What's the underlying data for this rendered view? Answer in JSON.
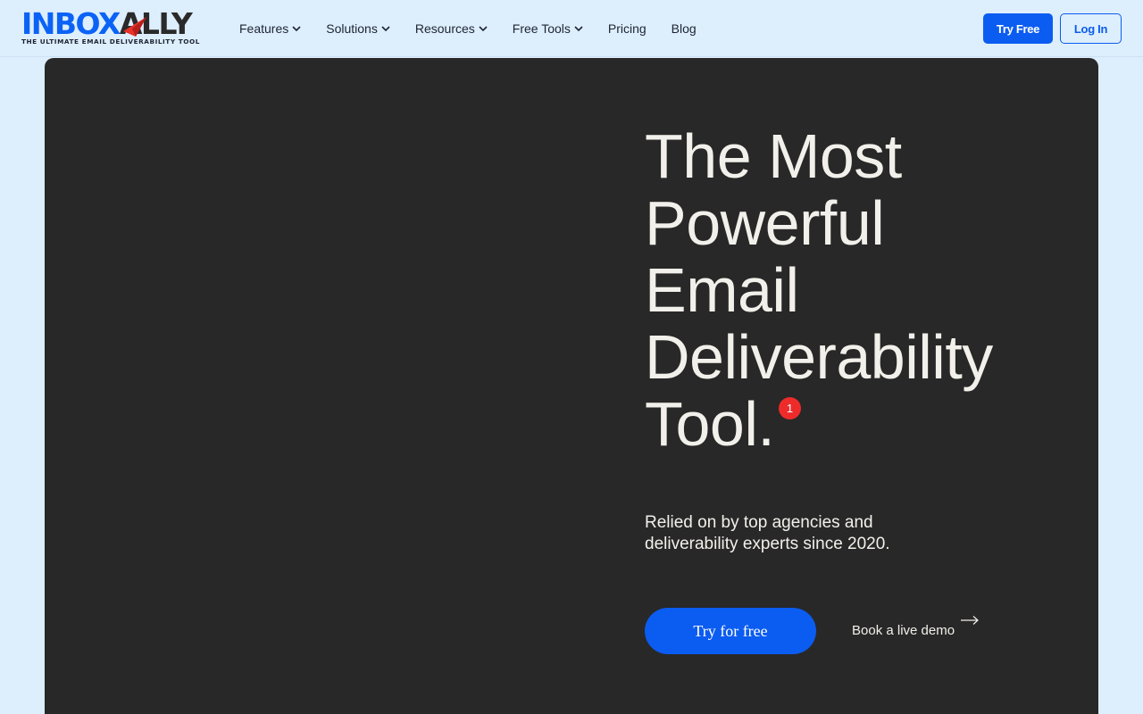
{
  "header": {
    "logo": {
      "word_part1": "INBOX",
      "word_part2": "ALLY",
      "tagline": "THE ULTIMATE EMAIL DELIVERABILITY TOOL"
    },
    "nav": [
      {
        "label": "Features",
        "has_dropdown": true
      },
      {
        "label": "Solutions",
        "has_dropdown": true
      },
      {
        "label": "Resources",
        "has_dropdown": true
      },
      {
        "label": "Free Tools",
        "has_dropdown": true
      },
      {
        "label": "Pricing",
        "has_dropdown": false
      },
      {
        "label": "Blog",
        "has_dropdown": false
      }
    ],
    "try_free_label": "Try Free",
    "login_label": "Log In"
  },
  "hero": {
    "title_lines": [
      "The Most",
      "Powerful",
      "Email",
      "Deliverability",
      "Tool."
    ],
    "notification_count": "1",
    "subtitle": "Relied on by top agencies and deliverability experts since 2020.",
    "cta_label": "Try for free",
    "demo_label": "Book a live demo"
  },
  "colors": {
    "page_bg": "#ddeefd",
    "hero_bg": "#282828",
    "brand_blue": "#0b5cf0",
    "badge_red": "#ee2b2b",
    "hero_text": "#f2f0ea"
  },
  "icons": {
    "logo_mark": "paper-plane-icon",
    "dropdown": "chevron-down-icon",
    "demo_arrow": "arrow-right-icon"
  }
}
